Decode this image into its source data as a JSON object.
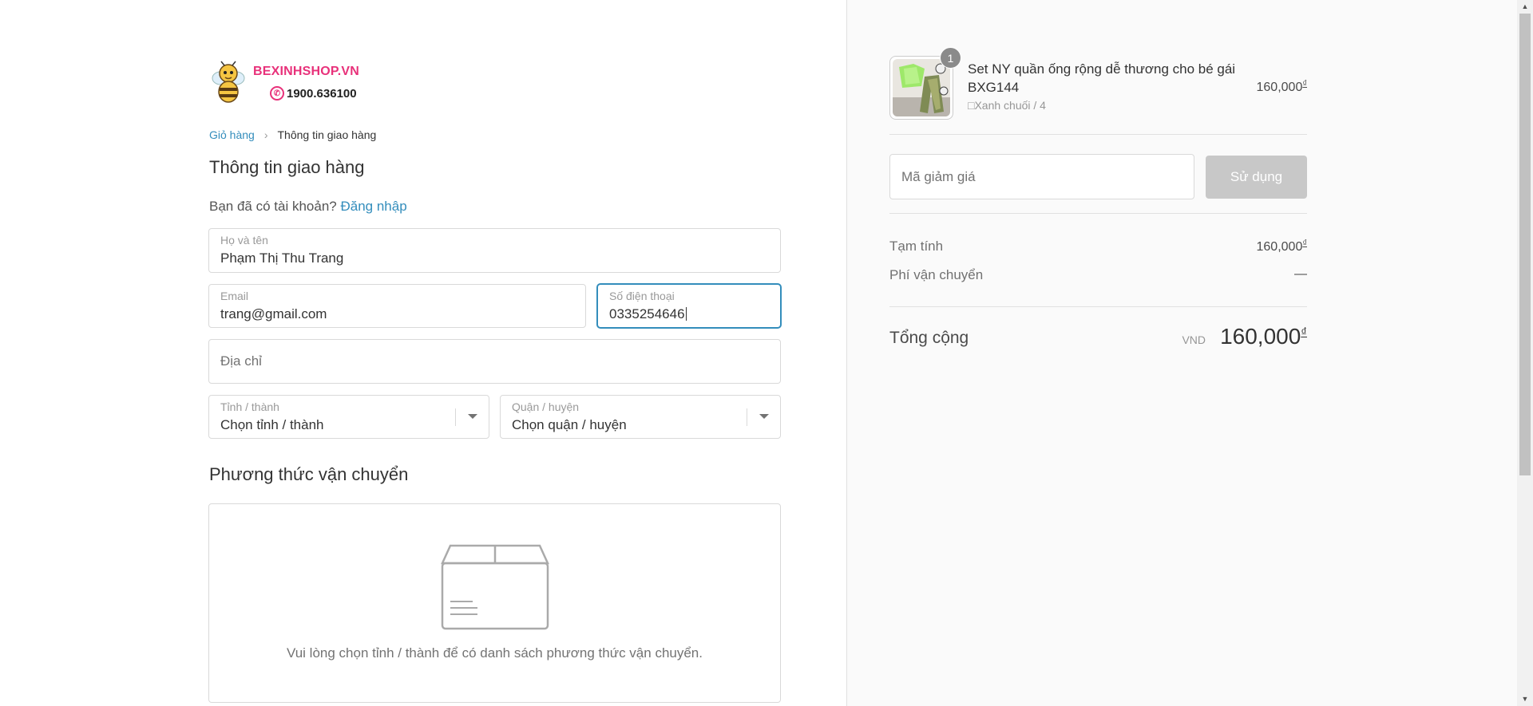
{
  "brand": {
    "name": "BEXINHSHOP.VN",
    "hotline": "1900.636100",
    "accent_color": "#e8317a"
  },
  "breadcrumb": {
    "cart": "Giỏ hàng",
    "current": "Thông tin giao hàng"
  },
  "shipping_info": {
    "title": "Thông tin giao hàng",
    "login_prompt": "Bạn đã có tài khoản?",
    "login_link": "Đăng nhập",
    "fullname": {
      "label": "Họ và tên",
      "value": "Phạm Thị Thu Trang"
    },
    "email": {
      "label": "Email",
      "value": "trang@gmail.com"
    },
    "phone": {
      "label": "Số điện thoại",
      "value": "0335254646"
    },
    "address": {
      "placeholder": "Địa chỉ"
    },
    "province": {
      "label": "Tỉnh / thành",
      "value": "Chọn tỉnh / thành"
    },
    "district": {
      "label": "Quận / huyện",
      "value": "Chọn quận / huyện"
    }
  },
  "shipping_method": {
    "title": "Phương thức vận chuyển",
    "message": "Vui lòng chọn tỉnh / thành để có danh sách phương thức vận chuyển."
  },
  "order_summary": {
    "product": {
      "name": "Set NY quần ống rộng dễ thương cho bé gái BXG144",
      "variant": "□Xanh chuối / 4",
      "price": "160,000",
      "quantity": "1"
    },
    "coupon": {
      "placeholder": "Mã giảm giá",
      "button": "Sử dụng"
    },
    "subtotal": {
      "label": "Tạm tính",
      "value": "160,000"
    },
    "shipping_fee": {
      "label": "Phí vận chuyển",
      "value": "—"
    },
    "total": {
      "label": "Tổng cộng",
      "currency": "VND",
      "value": "160,000"
    },
    "currency_symbol": "₫"
  },
  "colors": {
    "link": "#338dbc",
    "button_disabled": "#c8c8c8"
  }
}
